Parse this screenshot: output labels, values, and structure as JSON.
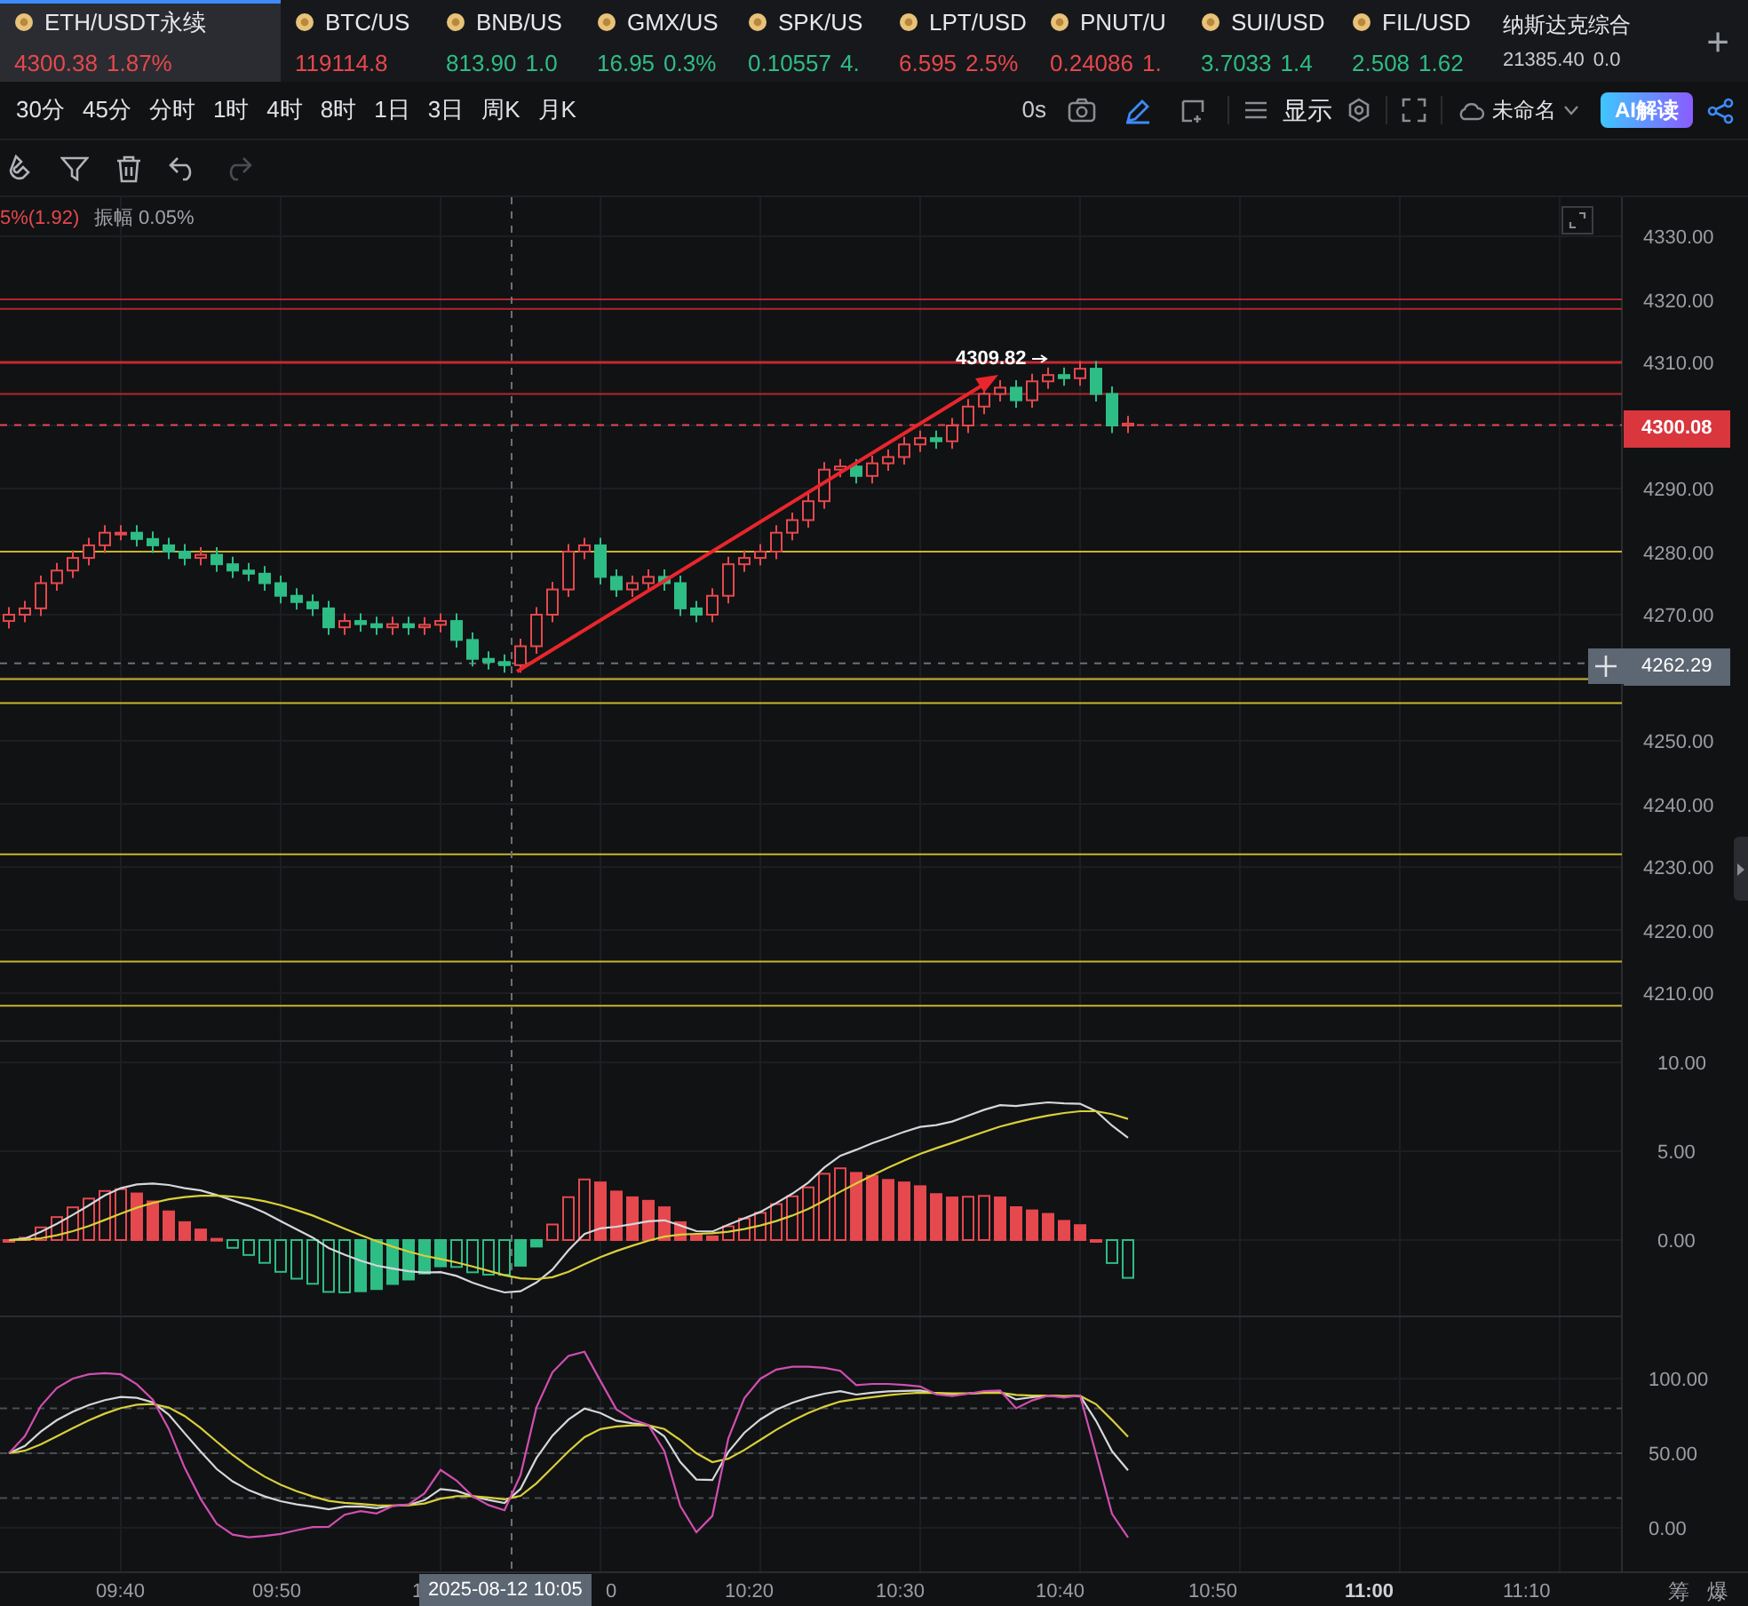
{
  "tickers": [
    {
      "symbol": "ETH/USDT永续",
      "price": "4300.38",
      "change": "1.87%",
      "color": "#e5484d",
      "selected": true,
      "icon": true
    },
    {
      "symbol": "BTC/US",
      "price": "119114.8",
      "color": "#e5484d",
      "selected": false,
      "icon": true
    },
    {
      "symbol": "BNB/US",
      "price": "813.90",
      "change": "1.0",
      "color": "#2ebd85",
      "selected": false,
      "icon": true
    },
    {
      "symbol": "GMX/US",
      "price": "16.95",
      "change": "0.3%",
      "color": "#2ebd85",
      "selected": false,
      "icon": true
    },
    {
      "symbol": "SPK/US",
      "price": "0.10557",
      "change": "4.",
      "color": "#2ebd85",
      "selected": false,
      "icon": true
    },
    {
      "symbol": "LPT/USD",
      "price": "6.595",
      "change": "2.5%",
      "color": "#e5484d",
      "selected": false,
      "icon": true
    },
    {
      "symbol": "PNUT/U",
      "price": "0.24086",
      "change": "1.",
      "color": "#e5484d",
      "selected": false,
      "icon": true
    },
    {
      "symbol": "SUI/USD",
      "price": "3.7033",
      "change": "1.4",
      "color": "#2ebd85",
      "selected": false,
      "icon": true
    },
    {
      "symbol": "FIL/USD",
      "price": "2.508",
      "change": "1.62",
      "color": "#2ebd85",
      "selected": false,
      "icon": true
    },
    {
      "symbol": "纳斯达克综合",
      "price": "21385.40",
      "change": "0.0",
      "color": "#c9cbd0",
      "selected": false,
      "icon": false
    }
  ],
  "add_tab": "+",
  "intervals": [
    "30分",
    "45分",
    "分时",
    "1时",
    "4时",
    "8时",
    "1日",
    "3日",
    "周K",
    "月K"
  ],
  "toolbar": {
    "refresh": "0s",
    "display": "显示",
    "layout_name": "未命名",
    "ai_button": "AI解读"
  },
  "drawing_tools": {
    "redo": {
      "disabled": true
    }
  },
  "chart": {
    "info_change": "5%(1.92)",
    "info_amplitude": "振幅 0.05%",
    "price_axis": [
      "4330.00",
      "4320.00",
      "4310.00",
      "4290.00",
      "4280.00",
      "4270.00",
      "4250.00",
      "4240.00",
      "4230.00",
      "4220.00",
      "4210.00"
    ],
    "last_price": "4300.08",
    "crosshair_price": "4262.29",
    "peak_label": "4309.82",
    "macd_axis": [
      "10.00",
      "5.00",
      "0.00"
    ],
    "kdj_axis": [
      "100.00",
      "50.00",
      "0.00"
    ],
    "time_axis": [
      {
        "text": "09:40",
        "bold": false
      },
      {
        "text": "09:50",
        "bold": false
      },
      {
        "text": "1",
        "bold": false
      },
      {
        "text": "0",
        "bold": false
      },
      {
        "text": "10:20",
        "bold": false
      },
      {
        "text": "10:30",
        "bold": false
      },
      {
        "text": "10:40",
        "bold": false
      },
      {
        "text": "10:50",
        "bold": false
      },
      {
        "text": "11:00",
        "bold": true
      },
      {
        "text": "11:10",
        "bold": false
      }
    ],
    "crosshair_time": "2025-08-12 10:05",
    "footer_buttons": [
      "筹",
      "爆"
    ]
  }
}
